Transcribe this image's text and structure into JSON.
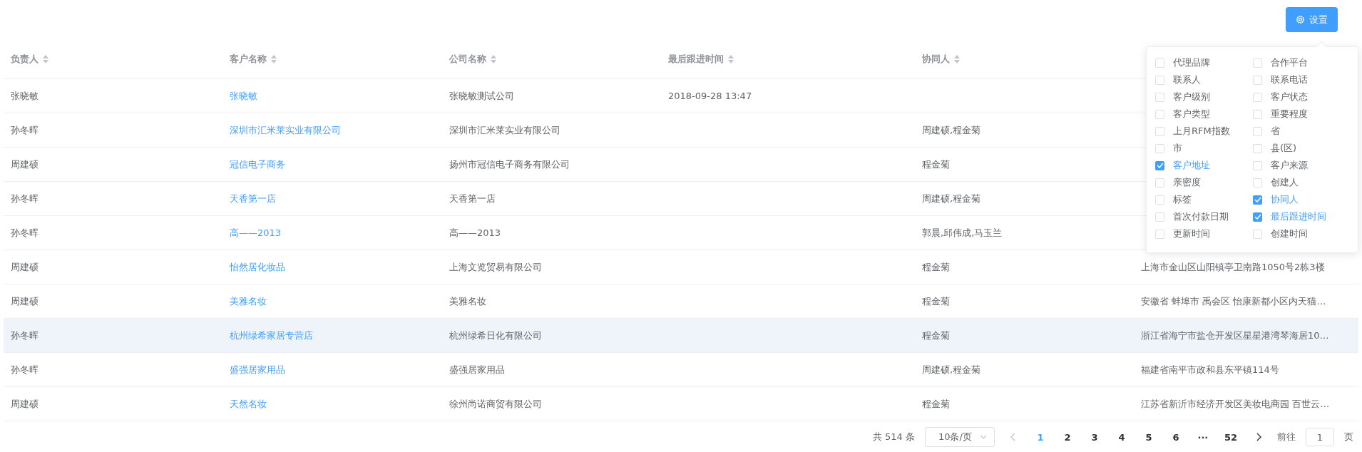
{
  "settings_button": {
    "label": "设置"
  },
  "table": {
    "columns": [
      {
        "label": "负责人"
      },
      {
        "label": "客户名称"
      },
      {
        "label": "公司名称"
      },
      {
        "label": "最后跟进时间"
      },
      {
        "label": "协同人"
      },
      {}
    ],
    "rows": [
      {
        "owner": "张晓敏",
        "customer": "张晓敏",
        "company": "张晓敏测试公司",
        "last_follow_up": "2018-09-28 13:47",
        "collaborators": null,
        "address": null,
        "highlighted": false
      },
      {
        "owner": "孙冬晖",
        "customer": "深圳市汇米莱实业有限公司",
        "company": "深圳市汇米莱实业有限公司",
        "last_follow_up": null,
        "collaborators": "周建硕,程金菊",
        "address": null,
        "highlighted": false
      },
      {
        "owner": "周建硕",
        "customer": "冠信电子商务",
        "company": "扬州市冠信电子商务有限公司",
        "last_follow_up": null,
        "collaborators": "程金菊",
        "address": null,
        "highlighted": false
      },
      {
        "owner": "孙冬晖",
        "customer": "天香第一店",
        "company": "天香第一店",
        "last_follow_up": null,
        "collaborators": "周建硕,程金菊",
        "address": null,
        "highlighted": false
      },
      {
        "owner": "孙冬晖",
        "customer": "高——2013",
        "company": "高——2013",
        "last_follow_up": null,
        "collaborators": "郭晨,邱伟成,马玉兰",
        "address": null,
        "highlighted": false
      },
      {
        "owner": "周建硕",
        "customer": "怡然居化妆品",
        "company": "上海文览贸易有限公司",
        "last_follow_up": null,
        "collaborators": "程金菊",
        "address": "上海市金山区山阳镇亭卫南路1050号2栋3楼",
        "highlighted": false
      },
      {
        "owner": "周建硕",
        "customer": "美雅名妆",
        "company": "美雅名妆",
        "last_follow_up": null,
        "collaborators": "程金菊",
        "address": "安徽省 蚌埠市 禹会区 怡康新都小区内天猫…",
        "highlighted": false
      },
      {
        "owner": "孙冬晖",
        "customer": "杭州绿希家居专营店",
        "company": "杭州绿希日化有限公司",
        "last_follow_up": null,
        "collaborators": "程金菊",
        "address": "浙江省海宁市盐仓开发区星星港湾琴海居10…",
        "highlighted": true
      },
      {
        "owner": "孙冬晖",
        "customer": "盛强居家用品",
        "company": "盛强居家用品",
        "last_follow_up": null,
        "collaborators": "周建硕,程金菊",
        "address": "福建省南平市政和县东平镇114号",
        "highlighted": false
      },
      {
        "owner": "周建硕",
        "customer": "天然名妆",
        "company": "徐州尚诺商贸有限公司",
        "last_follow_up": null,
        "collaborators": "程金菊",
        "address": "江苏省新沂市经济开发区美妆电商园 百世云…",
        "highlighted": false
      }
    ]
  },
  "column_settings": {
    "options": [
      {
        "label": "代理品牌",
        "checked": false
      },
      {
        "label": "合作平台",
        "checked": false
      },
      {
        "label": "联系人",
        "checked": false
      },
      {
        "label": "联系电话",
        "checked": false
      },
      {
        "label": "客户级别",
        "checked": false
      },
      {
        "label": "客户状态",
        "checked": false
      },
      {
        "label": "客户类型",
        "checked": false
      },
      {
        "label": "重要程度",
        "checked": false
      },
      {
        "label": "上月RFM指数",
        "checked": false
      },
      {
        "label": "省",
        "checked": false
      },
      {
        "label": "市",
        "checked": false
      },
      {
        "label": "县(区)",
        "checked": false
      },
      {
        "label": "客户地址",
        "checked": true
      },
      {
        "label": "客户来源",
        "checked": false
      },
      {
        "label": "亲密度",
        "checked": false
      },
      {
        "label": "创建人",
        "checked": false
      },
      {
        "label": "标签",
        "checked": false
      },
      {
        "label": "协同人",
        "checked": true
      },
      {
        "label": "首次付款日期",
        "checked": false
      },
      {
        "label": "最后跟进时间",
        "checked": true
      },
      {
        "label": "更新时间",
        "checked": false
      },
      {
        "label": "创建时间",
        "checked": false
      }
    ]
  },
  "pagination": {
    "total": "共 514 条",
    "page_size": "10条/页",
    "pages": [
      {
        "label": "1",
        "selected": true
      },
      {
        "label": "2",
        "selected": false
      },
      {
        "label": "3",
        "selected": false
      },
      {
        "label": "4",
        "selected": false
      },
      {
        "label": "5",
        "selected": false
      },
      {
        "label": "6",
        "selected": false
      },
      {
        "label": "···",
        "selected": false
      },
      {
        "label": "52",
        "selected": false
      }
    ],
    "goto_label": "前往",
    "goto_value": "1",
    "page_suffix": "页"
  }
}
